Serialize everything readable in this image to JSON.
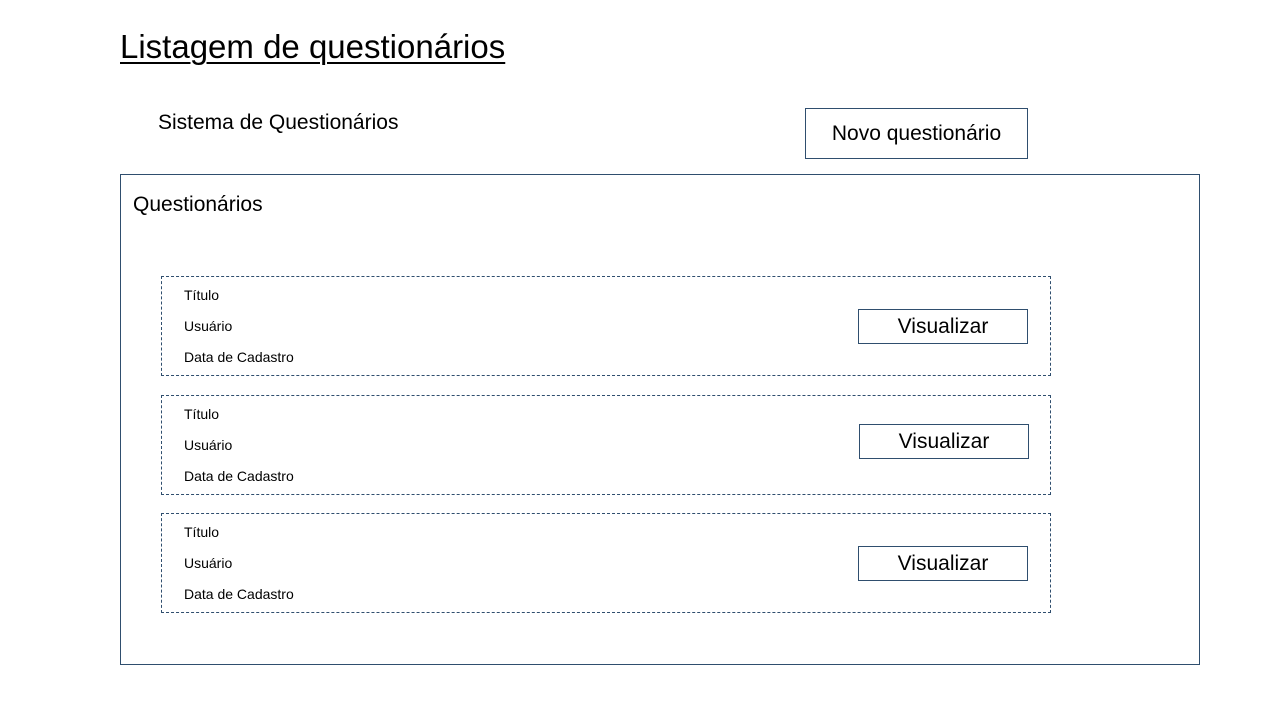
{
  "page": {
    "title": "Listagem de questionários",
    "system_name": "Sistema de Questionários",
    "new_button_label": "Novo questionário"
  },
  "panel": {
    "title": "Questionários",
    "cards": [
      {
        "title": "Título",
        "user": "Usuário",
        "date": "Data de Cadastro",
        "button_label": "Visualizar"
      },
      {
        "title": "Título",
        "user": "Usuário",
        "date": "Data de Cadastro",
        "button_label": "Visualizar"
      },
      {
        "title": "Título",
        "user": "Usuário",
        "date": "Data de Cadastro",
        "button_label": "Visualizar"
      }
    ]
  },
  "colors": {
    "border": "#2f4e6e",
    "background": "#ffffff",
    "text": "#000000"
  }
}
